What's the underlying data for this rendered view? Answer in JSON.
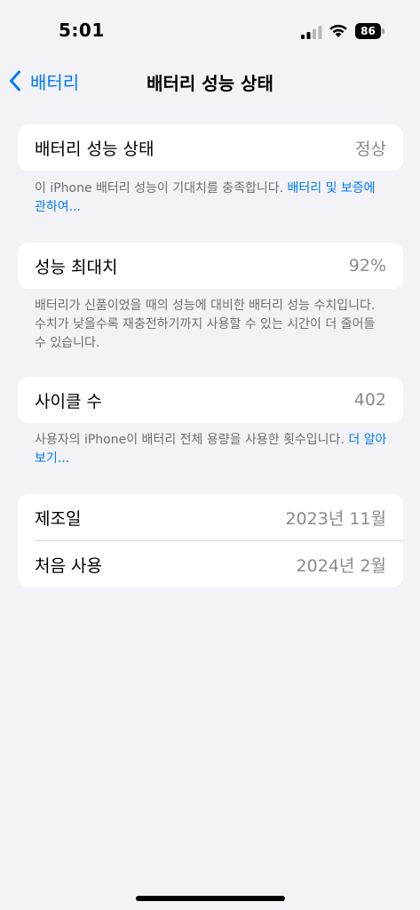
{
  "status": {
    "time": "5:01",
    "battery_level": "86"
  },
  "nav": {
    "back_label": "배터리",
    "title": "배터리 성능 상태"
  },
  "health": {
    "label": "배터리 성능 상태",
    "value": "정상",
    "footnote_text": "이 iPhone 배터리 성능이 기대치를 충족합니다. ",
    "footnote_link": "배터리 및 보증에 관하여..."
  },
  "max_capacity": {
    "label": "성능 최대치",
    "value": "92%",
    "footnote_text": "배터리가 신품이었을 때의 성능에 대비한 배터리 성능 수치입니다. 수치가 낮을수록 재충전하기까지 사용할 수 있는 시간이 더 줄어들 수 있습니다."
  },
  "cycle_count": {
    "label": "사이클 수",
    "value": "402",
    "footnote_text": "사용자의 iPhone이 배터리 전체 용량을 사용한 횟수입니다. ",
    "footnote_link": "더 알아보기..."
  },
  "dates": {
    "manufacture_label": "제조일",
    "manufacture_value": "2023년 11월",
    "first_use_label": "처음 사용",
    "first_use_value": "2024년 2월"
  },
  "colors": {
    "accent": "#007aff",
    "background": "#f2f2f7",
    "secondary_text": "#8a8a8e"
  }
}
